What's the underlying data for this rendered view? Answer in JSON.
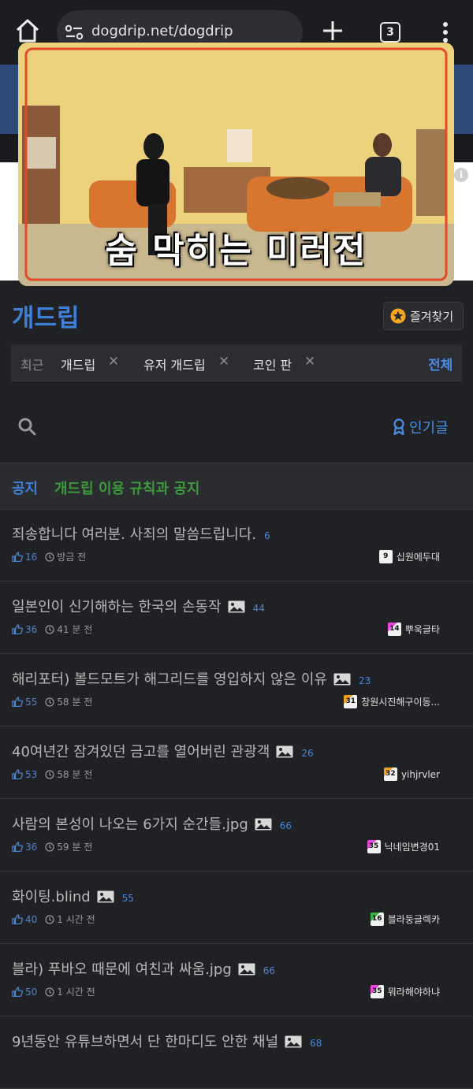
{
  "browser": {
    "url": "dogdrip.net/dogdrip",
    "tab_count": "3"
  },
  "ad": {
    "info_icon": "i"
  },
  "video": {
    "caption": "숨 막히는 미러전"
  },
  "board": {
    "title": "개드립",
    "favorite_label": "즐겨찾기",
    "recent_label": "최근",
    "recent_items": [
      "개드립",
      "유저 개드립",
      "코인 판"
    ],
    "recent_all": "전체",
    "popular_label": "인기글"
  },
  "notice": {
    "tag": "공지",
    "title": "개드립 이용 규칙과 공지"
  },
  "posts": [
    {
      "title": "죄송합니다 여러분. 사죄의 말씀드립니다.",
      "has_image": false,
      "comments": "6",
      "likes": "16",
      "time": "방금 전",
      "level": "9",
      "level_color": "#f2f2f2",
      "author": "십원에두대"
    },
    {
      "title": "일본인이 신기해하는 한국의 손동작",
      "has_image": true,
      "comments": "44",
      "likes": "36",
      "time": "41 분 전",
      "level": "14",
      "level_color": "#e84ae0",
      "author": "뿌욱글타"
    },
    {
      "title": "해리포터) 볼드모트가 해그리드를 영입하지 않은 이유",
      "has_image": true,
      "comments": "23",
      "likes": "55",
      "time": "58 분 전",
      "level": "31",
      "level_color": "#f0a020",
      "author": "창원시진해구이동..."
    },
    {
      "title": "40여년간 잠겨있던 금고를 열어버린 관광객",
      "has_image": true,
      "comments": "26",
      "likes": "53",
      "time": "58 분 전",
      "level": "32",
      "level_color": "#f0a020",
      "author": "yihjrvler"
    },
    {
      "title": "사람의 본성이 나오는 6가지 순간들.jpg",
      "has_image": true,
      "comments": "66",
      "likes": "36",
      "time": "59 분 전",
      "level": "35",
      "level_color": "#e84ae0",
      "author": "닉네임변경01"
    },
    {
      "title": "화이팅.blind",
      "has_image": true,
      "comments": "55",
      "likes": "40",
      "time": "1 시간 전",
      "level": "16",
      "level_color": "#3cb043",
      "author": "블라둥글렉카"
    },
    {
      "title": "블라) 푸바오 때문에 여친과 싸움.jpg",
      "has_image": true,
      "comments": "66",
      "likes": "50",
      "time": "1 시간 전",
      "level": "35",
      "level_color": "#e84ae0",
      "author": "뭐라해야하냐"
    },
    {
      "title": "9년동안 유튜브하면서 단 한마디도 안한 채널",
      "has_image": true,
      "comments": "68",
      "likes": "",
      "time": "",
      "level": "",
      "level_color": "#f0a020",
      "author": ""
    }
  ],
  "colors": {
    "accent_blue": "#3f7fd8",
    "notice_green": "#3c9a3c",
    "background": "#202124"
  }
}
